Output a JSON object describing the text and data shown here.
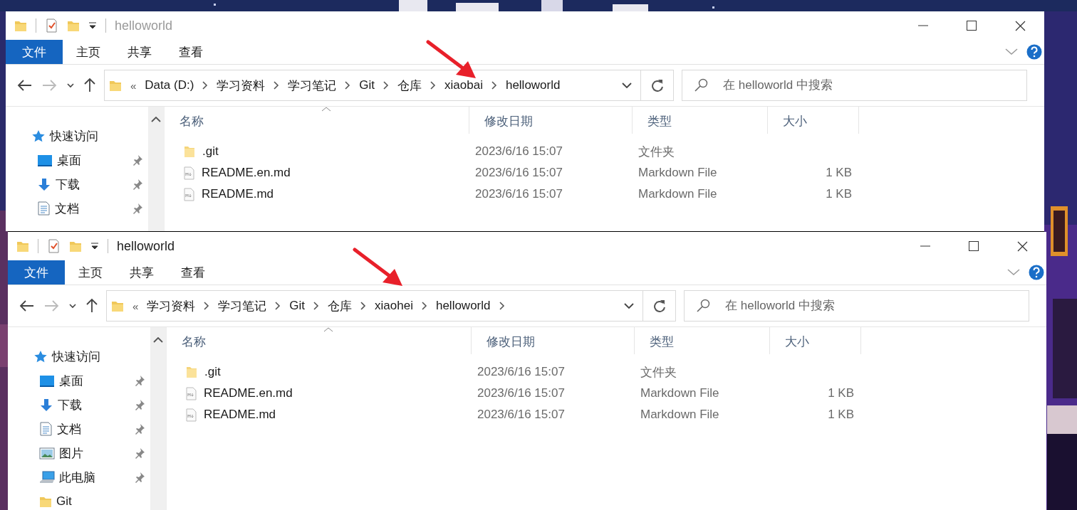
{
  "windows": [
    {
      "title": "helloworld",
      "active": false,
      "ribbon_tabs": [
        {
          "label": "文件",
          "kind": "file"
        },
        {
          "label": "主页",
          "kind": "tab"
        },
        {
          "label": "共享",
          "kind": "tab"
        },
        {
          "label": "查看",
          "kind": "tab"
        }
      ],
      "annotation": {
        "kind": "arrow"
      },
      "address": {
        "overflow_glyph": "«",
        "crumbs": [
          {
            "label": "Data (D:)"
          },
          {
            "label": "学习资料"
          },
          {
            "label": "学习笔记"
          },
          {
            "label": "Git"
          },
          {
            "label": "仓库"
          },
          {
            "label": "xiaobai"
          },
          {
            "label": "helloworld"
          }
        ],
        "trailing_chevron": false
      },
      "search": {
        "placeholder": "在 helloworld 中搜索"
      },
      "sidebar": [
        {
          "label": "快速访问",
          "kind": "star",
          "pinned": false,
          "children": [
            {
              "label": "桌面",
              "kind": "desktop",
              "pinned": true
            },
            {
              "label": "下载",
              "kind": "download",
              "pinned": true
            },
            {
              "label": "文档",
              "kind": "document",
              "pinned": true
            }
          ]
        }
      ],
      "columns": [
        {
          "label": "名称",
          "sorted": true
        },
        {
          "label": "修改日期",
          "sorted": false
        },
        {
          "label": "类型",
          "sorted": false
        },
        {
          "label": "大小",
          "sorted": false
        }
      ],
      "rows": [
        {
          "kind": "folder",
          "name": ".git",
          "date": "2023/6/16 15:07",
          "type": "文件夹"
        },
        {
          "kind": "markdown",
          "name": "README.en.md",
          "date": "2023/6/16 15:07",
          "type": "Markdown File",
          "size": "1 KB"
        },
        {
          "kind": "markdown",
          "name": "README.md",
          "date": "2023/6/16 15:07",
          "type": "Markdown File",
          "size": "1 KB"
        }
      ]
    },
    {
      "title": "helloworld",
      "active": true,
      "ribbon_tabs": [
        {
          "label": "文件",
          "kind": "file"
        },
        {
          "label": "主页",
          "kind": "tab"
        },
        {
          "label": "共享",
          "kind": "tab"
        },
        {
          "label": "查看",
          "kind": "tab"
        }
      ],
      "annotation": {
        "kind": "arrow"
      },
      "address": {
        "overflow_glyph": "«",
        "crumbs": [
          {
            "label": "学习资料"
          },
          {
            "label": "学习笔记"
          },
          {
            "label": "Git"
          },
          {
            "label": "仓库"
          },
          {
            "label": "xiaohei"
          },
          {
            "label": "helloworld"
          }
        ],
        "trailing_chevron": true
      },
      "search": {
        "placeholder": "在 helloworld 中搜索"
      },
      "sidebar": [
        {
          "label": "快速访问",
          "kind": "star",
          "pinned": false,
          "children": [
            {
              "label": "桌面",
              "kind": "desktop",
              "pinned": true
            },
            {
              "label": "下载",
              "kind": "download",
              "pinned": true
            },
            {
              "label": "文档",
              "kind": "document",
              "pinned": true
            },
            {
              "label": "图片",
              "kind": "pictures",
              "pinned": true
            },
            {
              "label": "此电脑",
              "kind": "pc",
              "pinned": true
            },
            {
              "label": "Git",
              "kind": "folder",
              "pinned": false
            }
          ]
        }
      ],
      "columns": [
        {
          "label": "名称",
          "sorted": true
        },
        {
          "label": "修改日期",
          "sorted": false
        },
        {
          "label": "类型",
          "sorted": false
        },
        {
          "label": "大小",
          "sorted": false
        }
      ],
      "rows": [
        {
          "kind": "folder",
          "name": ".git",
          "date": "2023/6/16 15:07",
          "type": "文件夹"
        },
        {
          "kind": "markdown",
          "name": "README.en.md",
          "date": "2023/6/16 15:07",
          "type": "Markdown File",
          "size": "1 KB"
        },
        {
          "kind": "markdown",
          "name": "README.md",
          "date": "2023/6/16 15:07",
          "type": "Markdown File",
          "size": "1 KB"
        }
      ]
    }
  ]
}
